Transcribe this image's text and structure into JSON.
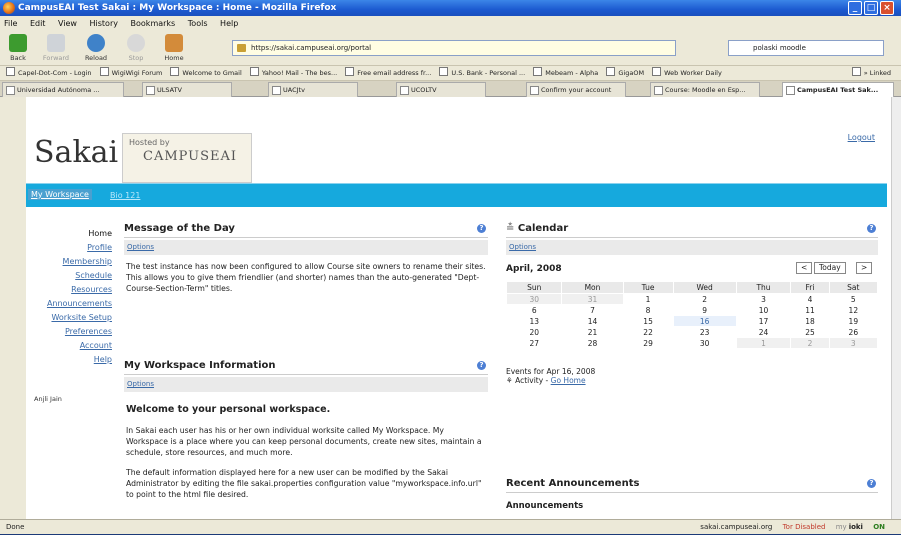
{
  "window": {
    "title": "CampusEAI Test Sakai : My Workspace : Home - Mozilla Firefox"
  },
  "menu": [
    "File",
    "Edit",
    "View",
    "History",
    "Bookmarks",
    "Tools",
    "Help"
  ],
  "nav": {
    "back": "Back",
    "forward": "Forward",
    "reload": "Reload",
    "stop": "Stop",
    "home": "Home"
  },
  "url": "https://sakai.campuseai.org/portal",
  "search": "polaski moodle",
  "bookmarks": [
    "Capel-Dot-Com - Login",
    "WigiWigi Forum",
    "Welcome to Gmail",
    "Yahoo! Mail - The bes...",
    "Free email address fr...",
    "U.S. Bank - Personal ...",
    "Mebeam - Alpha",
    "GigaOM",
    "Web Worker Daily",
    "» Linked"
  ],
  "tabs": [
    "Universidad Autónoma ...",
    "ULSATV",
    "UACJtv",
    "UCOLTV",
    "Confirm your account",
    "Course: Moodle en Esp...",
    "CampusEAI Test Sak..."
  ],
  "portal": {
    "logo": "Sakai",
    "hosted_by": "Hosted by",
    "hosted_org": "CAMPUSEAI",
    "logout": "Logout",
    "sites": [
      "My Workspace",
      "Bio 121"
    ],
    "tools": [
      "Home",
      "Profile",
      "Membership",
      "Schedule",
      "Resources",
      "Announcements",
      "Worksite Setup",
      "Preferences",
      "Account",
      "Help"
    ],
    "user": "Anjli Jain",
    "motd": {
      "title": "Message of the Day",
      "options": "Options",
      "text": "The test instance has now been configured to allow Course site owners to rename their sites. This allows you to give them friendlier (and shorter) names than the auto-generated \"Dept-Course-Section-Term\" titles."
    },
    "info": {
      "title": "My Workspace Information",
      "options": "Options",
      "heading": "Welcome to your personal workspace.",
      "p1": "In Sakai each user has his or her own individual worksite called My Workspace. My Workspace is a place where you can keep personal documents, create new sites, maintain a schedule, store resources, and much more.",
      "p2": "The default information displayed here for a new user can be modified by the Sakai Administrator by editing the file sakai.properties configuration value \"myworkspace.info.url\" to point to the html file desired."
    },
    "calendar": {
      "title": "Calendar",
      "options": "Options",
      "month": "April, 2008",
      "prev": "<",
      "today": "Today",
      "next": ">",
      "days": [
        "Sun",
        "Mon",
        "Tue",
        "Wed",
        "Thu",
        "Fri",
        "Sat"
      ],
      "weeks": [
        [
          "30",
          "31",
          "1",
          "2",
          "3",
          "4",
          "5"
        ],
        [
          "6",
          "7",
          "8",
          "9",
          "10",
          "11",
          "12"
        ],
        [
          "13",
          "14",
          "15",
          "16",
          "17",
          "18",
          "19"
        ],
        [
          "20",
          "21",
          "22",
          "23",
          "24",
          "25",
          "26"
        ],
        [
          "27",
          "28",
          "29",
          "30",
          "1",
          "2",
          "3"
        ]
      ],
      "events_for": "Events for Apr 16, 2008",
      "activity": "Activity -",
      "go_home": "Go Home"
    },
    "announcements": {
      "title": "Recent Announcements",
      "sub": "Announcements"
    }
  },
  "status": {
    "left": "Done",
    "domain": "sakai.campuseai.org",
    "tor": "Tor Disabled",
    "my": "my",
    "ioki": "ioki",
    "on": "ON"
  }
}
